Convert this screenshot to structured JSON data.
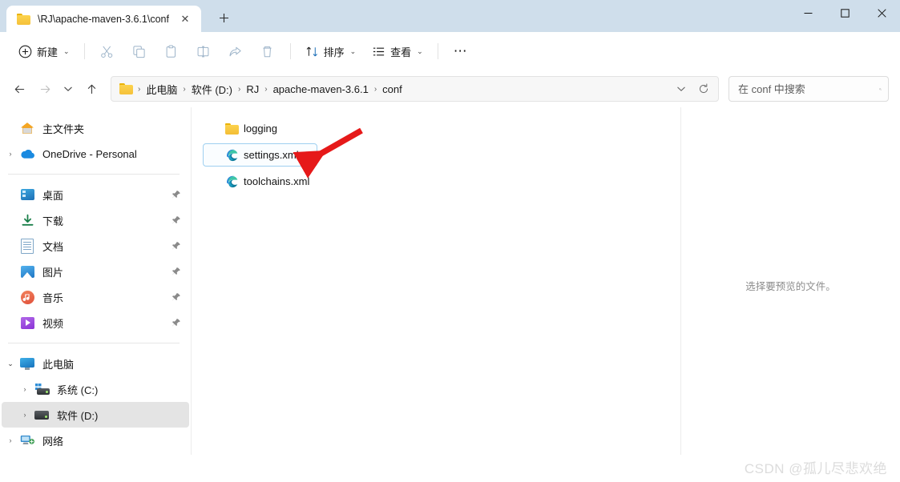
{
  "window": {
    "tab_title": "\\RJ\\apache-maven-3.6.1\\conf",
    "minimize_label": "—",
    "maximize_label": "□",
    "close_label": "✕",
    "new_tab_label": "+",
    "tab_close_label": "✕"
  },
  "toolbar": {
    "new_label": "新建",
    "sort_label": "排序",
    "view_label": "查看",
    "more_label": "⋯",
    "cut_name": "剪切",
    "copy_name": "复制",
    "paste_name": "粘贴",
    "rename_name": "重命名",
    "share_name": "共享",
    "delete_name": "删除",
    "caret": "⌄"
  },
  "address": {
    "back_label": "←",
    "forward_label": "→",
    "recent_label": "⌄",
    "up_label": "↑",
    "refresh_label": "⟳",
    "dropdown_label": "⌄",
    "separator": "›",
    "crumbs": [
      {
        "label": "此电脑"
      },
      {
        "label": "软件 (D:)"
      },
      {
        "label": "RJ"
      },
      {
        "label": "apache-maven-3.6.1"
      },
      {
        "label": "conf"
      }
    ]
  },
  "search": {
    "placeholder": "在 conf 中搜索",
    "value": ""
  },
  "sidebar": {
    "groups": [
      {
        "items": [
          {
            "label": "主文件夹",
            "icon": "home-icon",
            "chevron": "",
            "pinned": false,
            "selected": false,
            "indent": 0
          },
          {
            "label": "OneDrive - Personal",
            "icon": "cloud-icon",
            "chevron": "collapsed",
            "pinned": false,
            "selected": false,
            "indent": 0
          }
        ]
      },
      {
        "items": [
          {
            "label": "桌面",
            "icon": "desktop-icon",
            "chevron": "",
            "pinned": true,
            "selected": false,
            "indent": 0
          },
          {
            "label": "下载",
            "icon": "download-icon",
            "chevron": "",
            "pinned": true,
            "selected": false,
            "indent": 0
          },
          {
            "label": "文档",
            "icon": "documents-icon",
            "chevron": "",
            "pinned": true,
            "selected": false,
            "indent": 0
          },
          {
            "label": "图片",
            "icon": "pictures-icon",
            "chevron": "",
            "pinned": true,
            "selected": false,
            "indent": 0
          },
          {
            "label": "音乐",
            "icon": "music-icon",
            "chevron": "",
            "pinned": true,
            "selected": false,
            "indent": 0
          },
          {
            "label": "视频",
            "icon": "videos-icon",
            "chevron": "",
            "pinned": true,
            "selected": false,
            "indent": 0
          }
        ]
      },
      {
        "items": [
          {
            "label": "此电脑",
            "icon": "this-pc-icon",
            "chevron": "expanded",
            "pinned": false,
            "selected": false,
            "indent": 0
          },
          {
            "label": "系统 (C:)",
            "icon": "system-drive-icon",
            "chevron": "collapsed",
            "pinned": false,
            "selected": false,
            "indent": 1
          },
          {
            "label": "软件 (D:)",
            "icon": "drive-icon",
            "chevron": "collapsed",
            "pinned": false,
            "selected": true,
            "indent": 1
          },
          {
            "label": "网络",
            "icon": "network-icon",
            "chevron": "collapsed",
            "pinned": false,
            "selected": false,
            "indent": 0
          }
        ]
      }
    ],
    "chevron_collapsed": "›",
    "chevron_expanded": "⌄"
  },
  "files": [
    {
      "name": "logging",
      "type": "folder",
      "selected": false
    },
    {
      "name": "settings.xml",
      "type": "edge-xml",
      "selected": true
    },
    {
      "name": "toolchains.xml",
      "type": "edge-xml",
      "selected": false
    }
  ],
  "preview": {
    "empty_text": "选择要预览的文件。"
  },
  "watermark": {
    "text": "CSDN @孤儿尽悲欢绝"
  },
  "colors": {
    "titlebar": "#cfdeeb",
    "selection_border": "#9fd0f0",
    "sidebar_selected": "#e4e4e4",
    "annotation_red": "#e61919",
    "folder_yellow": "#f5c13a"
  }
}
